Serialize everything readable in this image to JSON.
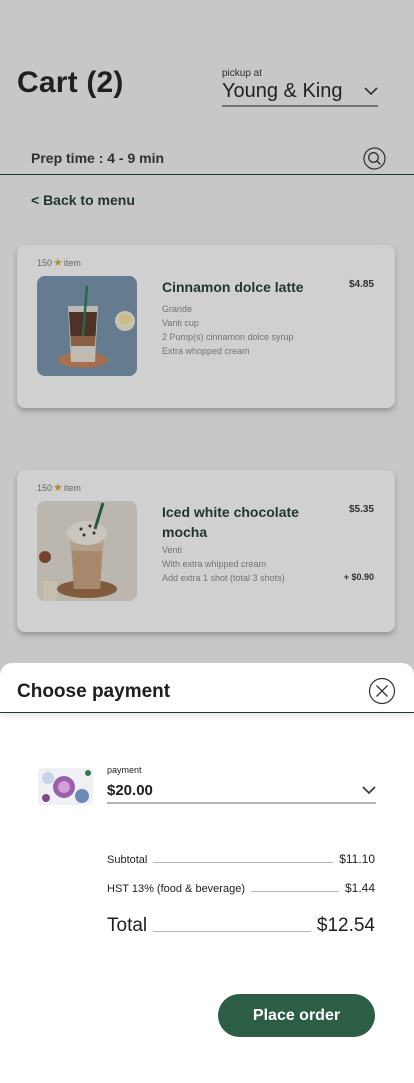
{
  "header": {
    "title": "Cart (2)",
    "pickup_label": "pickup at",
    "pickup_store": "Young & King",
    "prep_time": "Prep time : 4 - 9 min",
    "back_link": "< Back to menu"
  },
  "items": [
    {
      "stars": "150",
      "stars_suffix": "item",
      "name": "Cinnamon dolce latte",
      "price": "$4.85",
      "mods": [
        "Grande",
        "Vanti cup",
        "2 Pump(s) cinnamon dolce syrup",
        "Extra whopped cream"
      ]
    },
    {
      "stars": "150",
      "stars_suffix": "item",
      "name": "Iced white chocolate mocha",
      "price": "$5.35",
      "mods": [
        "Venti",
        "With extra whipped cream",
        "Add extra 1 shot (total 3 shots)"
      ],
      "extra_price": "+ $0.90"
    }
  ],
  "payment_sheet": {
    "title": "Choose payment",
    "payment_label": "payment",
    "payment_value": "$20.00",
    "subtotal_label": "Subtotal",
    "subtotal_value": "$11.10",
    "tax_label": "HST 13% (food & beverage)",
    "tax_value": "$1.44",
    "total_label": "Total",
    "total_value": "$12.54",
    "place_order": "Place order"
  },
  "colors": {
    "brand_green": "#1e3932",
    "button_green": "#2c5e45",
    "star_gold": "#d4a93e"
  },
  "icons": [
    "chevron-down-icon",
    "search-icon",
    "star-icon",
    "close-icon"
  ]
}
